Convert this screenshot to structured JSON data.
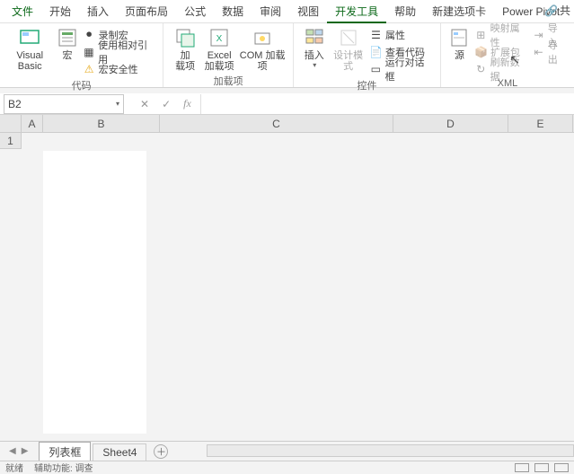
{
  "tabs": {
    "file": "文件",
    "home": "开始",
    "insert": "插入",
    "layout": "页面布局",
    "formulas": "公式",
    "data": "数据",
    "review": "审阅",
    "view": "视图",
    "developer": "开发工具",
    "help": "帮助",
    "newtab": "新建选项卡",
    "powerpivot": "Power Pivot"
  },
  "share": "共",
  "ribbon": {
    "code": {
      "vb": "Visual Basic",
      "macro": "宏",
      "record": "录制宏",
      "relref": "使用相对引用",
      "security": "宏安全性",
      "group": "代码"
    },
    "addins": {
      "addin": "加载项",
      "addin2": "载项",
      "excel": "Excel",
      "exceladdin": "加载项",
      "com": "COM 加载项",
      "group": "加载项"
    },
    "controls": {
      "insert": "插入",
      "design": "设计模式",
      "props": "属性",
      "viewcode": "查看代码",
      "dialog": "运行对话框",
      "group": "控件"
    },
    "xml": {
      "source": "源",
      "mapprops": "映射属性",
      "expand": "扩展包",
      "refresh": "刷新数据",
      "import": "导入",
      "export": "导出",
      "group": "XML"
    }
  },
  "namebox": "B2",
  "columns": [
    "A",
    "B",
    "C",
    "D",
    "E"
  ],
  "rows": [
    "1"
  ],
  "sheets": {
    "s1": "列表框",
    "s2": "Sheet4"
  },
  "status": {
    "left1": "就绪",
    "left2": "辅助功能: 调查"
  }
}
